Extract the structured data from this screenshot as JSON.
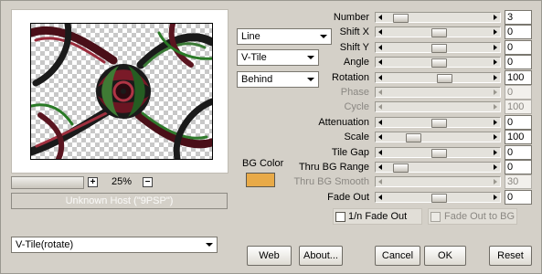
{
  "preview": {
    "zoom": "25%",
    "zoom_in": "+",
    "zoom_out": "−"
  },
  "status": {
    "host": "Unknown Host (\"9PSP\")"
  },
  "combos": {
    "mode": "Line",
    "tile": "V-Tile",
    "layer": "Behind"
  },
  "bg": {
    "label": "BG Color",
    "color": "#e8aa48"
  },
  "sliders": [
    {
      "label": "Number",
      "value": "3",
      "enabled": true,
      "pos": 0.05
    },
    {
      "label": "Shift X",
      "value": "0",
      "enabled": true,
      "pos": 0.5
    },
    {
      "label": "Shift Y",
      "value": "0",
      "enabled": true,
      "pos": 0.5
    },
    {
      "label": "Angle",
      "value": "0",
      "enabled": true,
      "pos": 0.5
    },
    {
      "label": "Rotation",
      "value": "100",
      "enabled": true,
      "pos": 0.57
    },
    {
      "label": "Phase",
      "value": "0",
      "enabled": false,
      "pos": 0.5
    },
    {
      "label": "Cycle",
      "value": "100",
      "enabled": false,
      "pos": 0.5
    },
    {
      "label": "Attenuation",
      "value": "0",
      "enabled": true,
      "pos": 0.5
    },
    {
      "label": "Scale",
      "value": "100",
      "enabled": true,
      "pos": 0.2
    },
    {
      "label": "Tile Gap",
      "value": "0",
      "enabled": true,
      "pos": 0.5
    },
    {
      "label": "Thru BG Range",
      "value": "0",
      "enabled": true,
      "pos": 0.05
    },
    {
      "label": "Thru BG Smooth",
      "value": "30",
      "enabled": false,
      "pos": 0.5
    },
    {
      "label": "Fade Out",
      "value": "0",
      "enabled": true,
      "pos": 0.5
    }
  ],
  "checks": {
    "fade_inv": "1/n Fade Out",
    "fade_bg": "Fade Out to BG"
  },
  "preset": "V-Tile(rotate)",
  "buttons": {
    "web": "Web",
    "about": "About...",
    "cancel": "Cancel",
    "ok": "OK",
    "reset": "Reset"
  },
  "icons": {
    "dropdown": "chevron-down-icon",
    "left": "arrow-left-icon",
    "right": "arrow-right-icon"
  }
}
